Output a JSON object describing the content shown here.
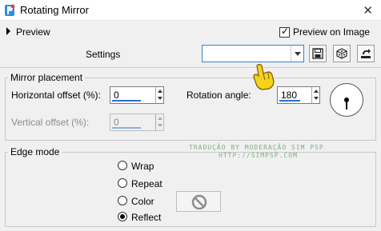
{
  "window": {
    "title": "Rotating Mirror",
    "close_glyph": "✕"
  },
  "preview": {
    "label": "Preview",
    "checkbox_label": "Preview on Image",
    "checked": true
  },
  "settings": {
    "label": "Settings",
    "combo_value": ""
  },
  "mirror_placement": {
    "title": "Mirror placement",
    "horizontal_label": "Horizontal offset (%):",
    "horizontal_value": "0",
    "vertical_label": "Vertical offset (%):",
    "vertical_value": "0",
    "rotation_label": "Rotation angle:",
    "rotation_value": "180"
  },
  "edge_mode": {
    "title": "Edge mode",
    "options": [
      "Wrap",
      "Repeat",
      "Color",
      "Reflect"
    ],
    "selected": "Reflect"
  },
  "watermark": {
    "line1": "TRADUÇÃO BY MODERAÇÃO SIM PSP",
    "line2": "HTTP://SIMPSP.COM"
  }
}
